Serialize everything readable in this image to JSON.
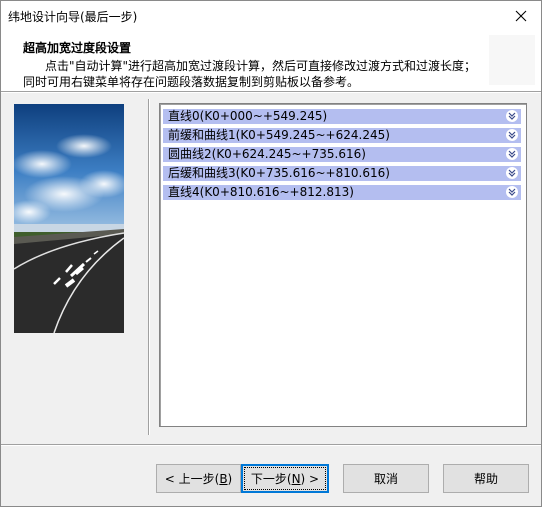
{
  "window": {
    "title": "纬地设计向导(最后一步)"
  },
  "header": {
    "title": "超高加宽过度段设置",
    "desc_line1": "点击\"自动计算\"进行超高加宽过渡段计算，然后可直接修改过渡方式和过渡长度；",
    "desc_line2": "同时可用右键菜单将存在问题段落数据复制到剪贴板以备参考。"
  },
  "tree": {
    "items": [
      {
        "label": "直线0(K0+000~+549.245)"
      },
      {
        "label": "前缓和曲线1(K0+549.245~+624.245)"
      },
      {
        "label": "圆曲线2(K0+624.245~+735.616)"
      },
      {
        "label": "后缓和曲线3(K0+735.616~+810.616)"
      },
      {
        "label": "直线4(K0+810.616~+812.813)"
      }
    ]
  },
  "buttons": {
    "prev_prefix": "< 上一步(",
    "prev_key": "B",
    "prev_suffix": ")",
    "next_prefix": "下一步(",
    "next_key": "N",
    "next_suffix": ") >",
    "cancel": "取消",
    "help": "帮助"
  },
  "icons": {
    "close": "close-icon",
    "expand": "double-chevron-down-icon"
  },
  "colors": {
    "tree_item_bg": "#b4bef0",
    "focus_border": "#0078d7"
  }
}
